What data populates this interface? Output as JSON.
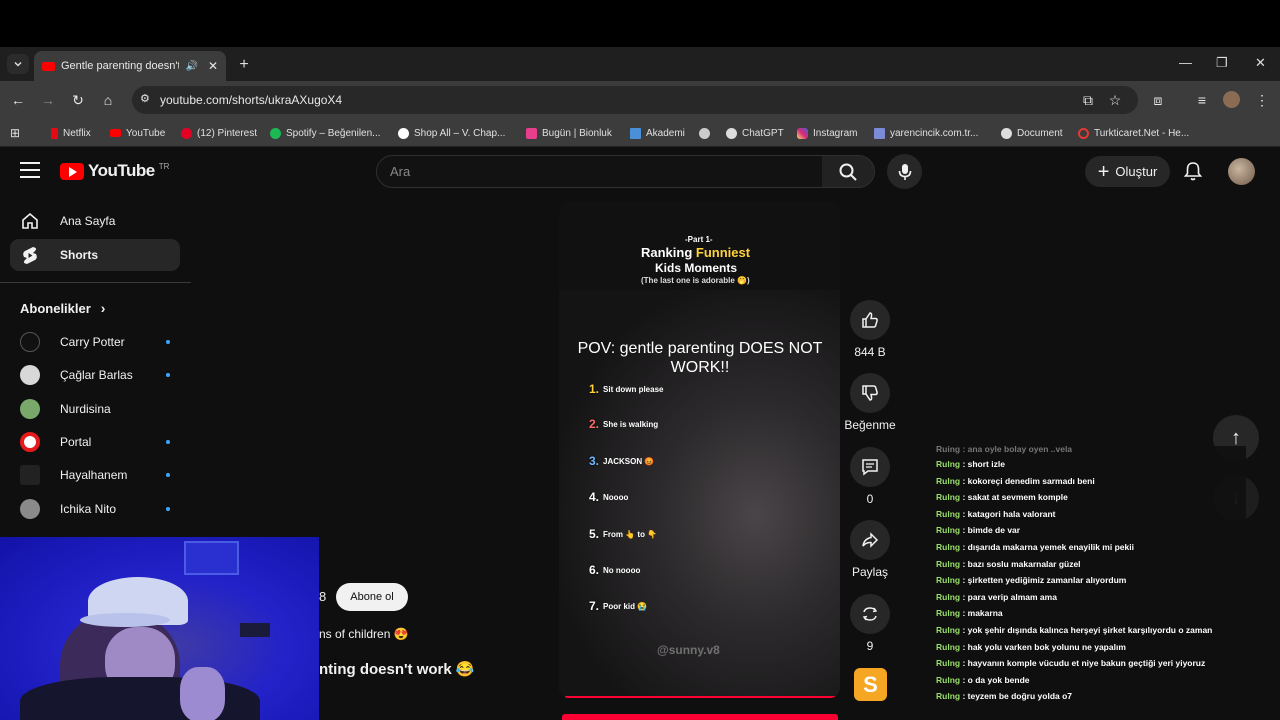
{
  "browser": {
    "tab_title": "Gentle parenting doesn't w",
    "url": "youtube.com/shorts/ukraAXugoX4",
    "bookmarks": [
      {
        "label": "Netflix",
        "color": "#e50914"
      },
      {
        "label": "YouTube",
        "color": "#ff0000"
      },
      {
        "label": "(12) Pinterest",
        "color": "#e60023"
      },
      {
        "label": "Spotify – Beğenilen...",
        "color": "#1db954"
      },
      {
        "label": "Shop All – V. Chap...",
        "color": "#ffffff"
      },
      {
        "label": "Bugün | Bionluk",
        "color": "#e83e8c"
      },
      {
        "label": "Akademi",
        "color": "#4a90d9"
      },
      {
        "label": "",
        "color": "#cccccc"
      },
      {
        "label": "ChatGPT",
        "color": "#dddddd"
      },
      {
        "label": "Instagram",
        "color": "#d62976"
      },
      {
        "label": "yarencincik.com.tr...",
        "color": "#7b8ad9"
      },
      {
        "label": "Document",
        "color": "#dddddd"
      },
      {
        "label": "Turkticaret.Net - He...",
        "color": "#e53935"
      }
    ]
  },
  "youtube": {
    "logo_text": "YouTube",
    "country": "TR",
    "search_placeholder": "Ara",
    "create_label": "Oluştur"
  },
  "sidebar": {
    "items": [
      {
        "label": "Ana Sayfa",
        "icon": "home-icon"
      },
      {
        "label": "Shorts",
        "icon": "shorts-icon"
      }
    ],
    "subscriptions_title": "Abonelikler",
    "subscriptions": [
      {
        "name": "Carry Potter",
        "color": "#111111",
        "dot": true
      },
      {
        "name": "Çağlar Barlas",
        "color": "#d8d8d8",
        "dot": true
      },
      {
        "name": "Nurdisina",
        "color": "#7aa86b",
        "dot": false
      },
      {
        "name": "Portal",
        "color": "#e51b1b",
        "dot": true
      },
      {
        "name": "Hayalhanem",
        "color": "#222222",
        "dot": true
      },
      {
        "name": "Ichika Nito",
        "color": "#8a8a8a",
        "dot": true
      }
    ]
  },
  "short": {
    "overlay_part": "-Part 1-",
    "overlay_title_a": "Ranking",
    "overlay_title_b": "Funniest",
    "overlay_title_c": "Kids Moments",
    "overlay_sub": "(The last one is adorable 🤭)",
    "pov_text": "POV: gentle parenting DOES NOT WORK!!",
    "ranking": [
      {
        "n": "1.",
        "text": "Sit down please"
      },
      {
        "n": "2.",
        "text": "She is walking"
      },
      {
        "n": "3.",
        "text": "JACKSON 😡"
      },
      {
        "n": "4.",
        "text": "Noooo"
      },
      {
        "n": "5.",
        "text": "From 👆 to 👇"
      },
      {
        "n": "6.",
        "text": "No noooo"
      },
      {
        "n": "7.",
        "text": "Poor kid 😭"
      }
    ],
    "watermark": "@sunny.v8",
    "channel_partial": "8",
    "subscribe_label": "Abone ol",
    "desc_partial": "ns of children 😍",
    "title_partial": "nting doesn't work 😂"
  },
  "actions": {
    "likes": "844 B",
    "dislike_label": "Beğenme",
    "comments": "0",
    "share_label": "Paylaş",
    "remix_count": "9"
  },
  "chat": {
    "partial_top": "Ruing : ana oyle bolay oyen ..vela",
    "messages": [
      {
        "user": "Rulng",
        "text": "short izle"
      },
      {
        "user": "Rulng",
        "text": "kokoreçi denedim sarmadı beni"
      },
      {
        "user": "Rulng",
        "text": "sakat at sevmem komple"
      },
      {
        "user": "Rulng",
        "text": "katagori hala valorant"
      },
      {
        "user": "Rulng",
        "text": "bimde de var"
      },
      {
        "user": "Rulng",
        "text": "dışarıda makarna yemek enayilik mi pekii"
      },
      {
        "user": "Rulng",
        "text": "bazı soslu makarnalar güzel"
      },
      {
        "user": "Rulng",
        "text": "şirketten yediğimiz zamanlar alıyordum"
      },
      {
        "user": "Rulng",
        "text": "para verip almam ama"
      },
      {
        "user": "Rulng",
        "text": "makarna"
      },
      {
        "user": "Rulng",
        "text": "yok şehir dışında kalınca herşeyi şirket karşılıyordu o zaman"
      },
      {
        "user": "Rulng",
        "text": "hak yolu varken bok yolunu ne yapalım"
      },
      {
        "user": "Rulng",
        "text": "hayvanın komple vücudu et niye bakun geçtiği yeri yiyoruz"
      },
      {
        "user": "Rulng",
        "text": "o da yok bende"
      },
      {
        "user": "Rulng",
        "text": "teyzem be doğru yolda o7"
      }
    ]
  }
}
